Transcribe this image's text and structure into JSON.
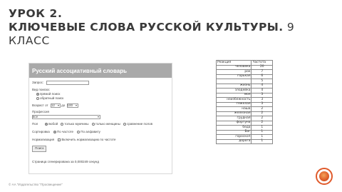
{
  "slide": {
    "title_line1": "УРОК 2.",
    "title_line2_bold": "КЛЮЧЕВЫЕ СЛОВА РУССКОЙ КУЛЬТУРЫ.",
    "title_line2_rest": " 9",
    "title_line3": "КЛАСС",
    "footer": "© АА \"Издательство \"Просвещение\"",
    "accent_color": "#e05a2b"
  },
  "form": {
    "header": "Русский ассоциативный словарь",
    "query_label": "Запрос:",
    "query_value": "",
    "search_type_label": "Вид поиска:",
    "search_direct": "прямой поиск",
    "search_reverse": "обратный поиск",
    "age_label": "Возраст от",
    "age_from": "12",
    "age_to_label": "до",
    "age_to": "100",
    "profession_label": "Профессия",
    "profession_value": "все",
    "gender_label": "Пол",
    "gender_any": "любой",
    "gender_men": "только мужчины",
    "gender_women": "только женщины",
    "gender_compare": "сравнение полов",
    "sort_label": "Сортировка",
    "sort_freq": "По частоте",
    "sort_alpha": "По алфавиту",
    "norm_label": "Нормализация",
    "norm_option": "Включить нормализацию по частоте",
    "submit_label": "Поиск",
    "generated_text": "Страница сгенерирована за 0,000249 секунд"
  },
  "table": {
    "headers": [
      "Реакция",
      "Частота"
    ],
    "rows": [
      {
        "word": "человека",
        "count": "20"
      },
      {
        "word": "рок",
        "count": "7"
      },
      {
        "word": "горькая",
        "count": "6"
      },
      {
        "word": "",
        "count": "5"
      },
      {
        "word": "жизнь",
        "count": "4"
      },
      {
        "word": "злодейка",
        "count": "4"
      },
      {
        "word": "моя",
        "count": "3"
      },
      {
        "word": "неизбежность",
        "count": "3"
      },
      {
        "word": "тяжелая",
        "count": "3"
      },
      {
        "word": "наша",
        "count": "2"
      },
      {
        "word": "железная",
        "count": "2"
      },
      {
        "word": "грудная",
        "count": "2"
      },
      {
        "word": "фортуна",
        "count": "2"
      },
      {
        "word": "беда",
        "count": "1"
      },
      {
        "word": "Бог",
        "count": "1"
      },
      {
        "word": "гороскоп",
        "count": "1"
      },
      {
        "word": "дорога",
        "count": "1"
      }
    ]
  }
}
